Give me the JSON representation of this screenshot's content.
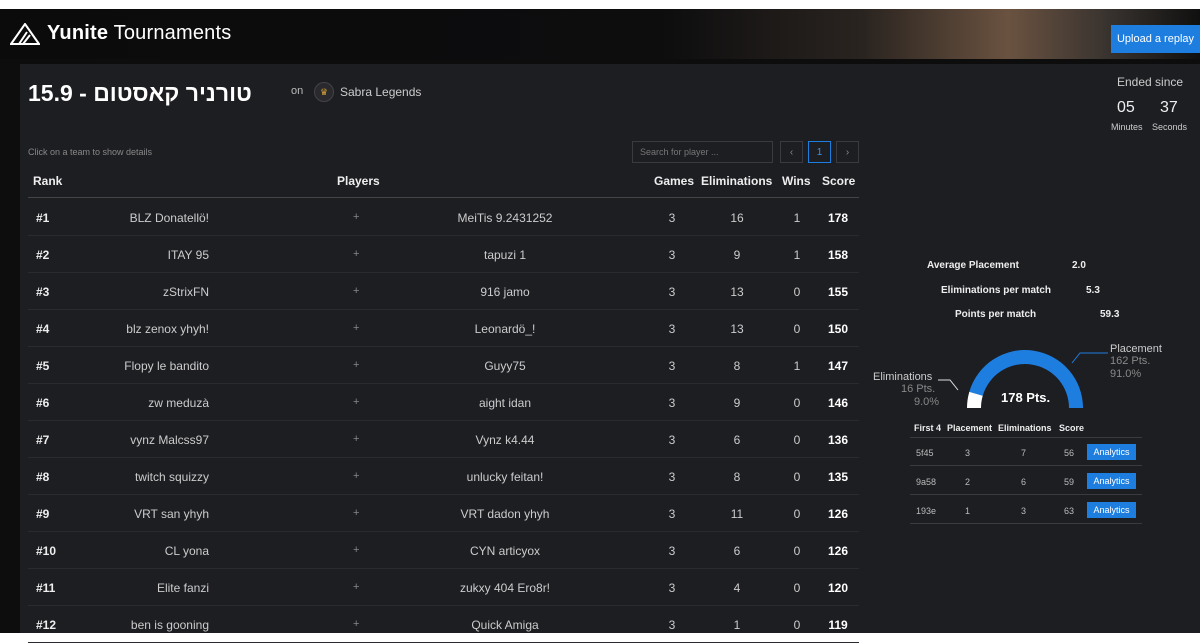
{
  "header": {
    "brand_bold": "Yunite",
    "brand_rest": " Tournaments",
    "upload_label": "Upload a replay"
  },
  "tournament": {
    "title": "15.9 - טורניר קאסטום",
    "on": "on",
    "org_name": "Sabra Legends"
  },
  "countdown": {
    "label": "Ended since",
    "minutes": "05",
    "seconds": "37",
    "minutes_label": "Minutes",
    "seconds_label": "Seconds"
  },
  "leaderboard": {
    "hint": "Click on a team to show details",
    "search_placeholder": "Search for player ...",
    "pagination": {
      "prev": "‹",
      "current": "1",
      "next": "›"
    },
    "columns": {
      "rank": "Rank",
      "players": "Players",
      "games": "Games",
      "eliminations": "Eliminations",
      "wins": "Wins",
      "score": "Score"
    },
    "plus": "+",
    "rows": [
      {
        "rank": "#1",
        "p1": "BLZ Donatellö!",
        "p2": "MeiTis 9.2431252",
        "games": "3",
        "elims": "16",
        "wins": "1",
        "score": "178"
      },
      {
        "rank": "#2",
        "p1": "ITAY 95",
        "p2": "tapuzi 1",
        "games": "3",
        "elims": "9",
        "wins": "1",
        "score": "158"
      },
      {
        "rank": "#3",
        "p1": "zStrixFN",
        "p2": "916 jamo",
        "games": "3",
        "elims": "13",
        "wins": "0",
        "score": "155"
      },
      {
        "rank": "#4",
        "p1": "blz zenox yhyh!",
        "p2": "Leonardö_!",
        "games": "3",
        "elims": "13",
        "wins": "0",
        "score": "150"
      },
      {
        "rank": "#5",
        "p1": "Flopy le bandito",
        "p2": "Guyy75",
        "games": "3",
        "elims": "8",
        "wins": "1",
        "score": "147"
      },
      {
        "rank": "#6",
        "p1": "zw meduzà",
        "p2": "aight idan",
        "games": "3",
        "elims": "9",
        "wins": "0",
        "score": "146"
      },
      {
        "rank": "#7",
        "p1": "vynz Malcss97",
        "p2": "Vynz k4.44",
        "games": "3",
        "elims": "6",
        "wins": "0",
        "score": "136"
      },
      {
        "rank": "#8",
        "p1": "twitch squizzy",
        "p2": "unlucky feitan!",
        "games": "3",
        "elims": "8",
        "wins": "0",
        "score": "135"
      },
      {
        "rank": "#9",
        "p1": "VRT san yhyh",
        "p2": "VRT dadon yhyh",
        "games": "3",
        "elims": "11",
        "wins": "0",
        "score": "126"
      },
      {
        "rank": "#10",
        "p1": "CL yona",
        "p2": "CYN articyox",
        "games": "3",
        "elims": "6",
        "wins": "0",
        "score": "126"
      },
      {
        "rank": "#11",
        "p1": "Elite fanzi",
        "p2": "zukxy 404 Ero8r!",
        "games": "3",
        "elims": "4",
        "wins": "0",
        "score": "120"
      },
      {
        "rank": "#12",
        "p1": "ben is gooning",
        "p2": "Quick Amiga",
        "games": "3",
        "elims": "1",
        "wins": "0",
        "score": "119"
      }
    ]
  },
  "team_stats": {
    "avg_placement_label": "Average Placement",
    "avg_placement": "2.0",
    "elims_per_match_label": "Eliminations per match",
    "elims_per_match": "5.3",
    "points_per_match_label": "Points per match",
    "points_per_match": "59.3"
  },
  "gauge": {
    "total": "178 Pts.",
    "elim_label": "Eliminations",
    "elim_pts": "16 Pts.",
    "elim_pct": "9.0%",
    "elim_fraction": 0.09,
    "placement_label": "Placement",
    "placement_pts": "162 Pts.",
    "placement_pct": "91.0%",
    "colors": {
      "placement": "#1e7ee0",
      "eliminations": "#ffffff"
    }
  },
  "matches": {
    "headers": {
      "id": "First 4",
      "placement": "Placement",
      "eliminations": "Eliminations",
      "score": "Score"
    },
    "button_label": "Analytics",
    "rows": [
      {
        "id": "5f45",
        "placement": "3",
        "elims": "7",
        "score": "56"
      },
      {
        "id": "9a58",
        "placement": "2",
        "elims": "6",
        "score": "59"
      },
      {
        "id": "193e",
        "placement": "1",
        "elims": "3",
        "score": "63"
      }
    ]
  }
}
